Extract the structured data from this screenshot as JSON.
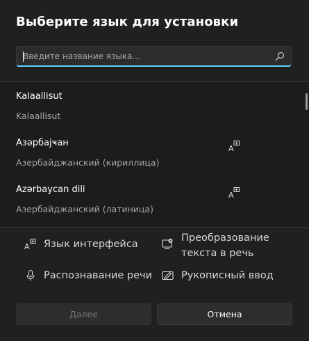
{
  "dialog": {
    "title": "Выберите язык для установки"
  },
  "search": {
    "placeholder": "Введите название языка...",
    "value": ""
  },
  "languages": [
    {
      "name": "Kalaallisut",
      "native": "Kalaallisut",
      "has_display_language": false
    },
    {
      "name": "Азәрбајҹан",
      "native": "Азербайджанский (кириллица)",
      "has_display_language": true
    },
    {
      "name": "Azərbaycan dili",
      "native": "Азербайджанский (латиница)",
      "has_display_language": true
    }
  ],
  "features": {
    "display_language": "Язык интерфейса",
    "tts_line1": "Преобразование",
    "tts_line2": "текста в речь",
    "speech": "Распознавание речи",
    "handwriting": "Рукописный ввод"
  },
  "buttons": {
    "next": "Далее",
    "cancel": "Отмена"
  },
  "colors": {
    "accent": "#60cdff",
    "background": "#202020",
    "list_background": "#1c1c1c"
  }
}
